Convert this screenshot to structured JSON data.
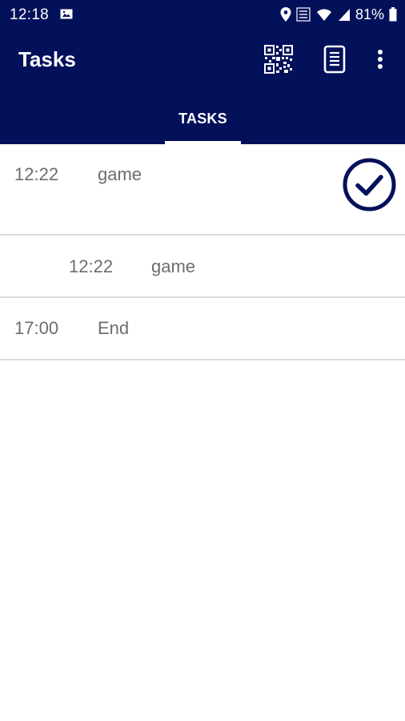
{
  "status_bar": {
    "time": "12:18",
    "battery": "81%",
    "icons": [
      "gallery-icon",
      "location-icon",
      "volte-icon",
      "wifi-icon",
      "signal-icon",
      "battery-icon"
    ]
  },
  "app_bar": {
    "title": "Tasks",
    "actions": [
      "qr-code-icon",
      "document-icon",
      "more-vert-icon"
    ]
  },
  "tabs": [
    {
      "label": "TASKS",
      "selected": true
    }
  ],
  "tasks": [
    {
      "time": "12:22",
      "name": "game",
      "indented": false,
      "action": "check-circle-icon"
    },
    {
      "time": "12:22",
      "name": "game",
      "indented": true
    },
    {
      "time": "17:00",
      "name": "End",
      "indented": false
    }
  ],
  "colors": {
    "header_bg": "#03105a",
    "header_text": "#ffffff",
    "list_text": "#6d6d6d",
    "divider": "#dcdcdc",
    "check_icon": "#03105a"
  }
}
